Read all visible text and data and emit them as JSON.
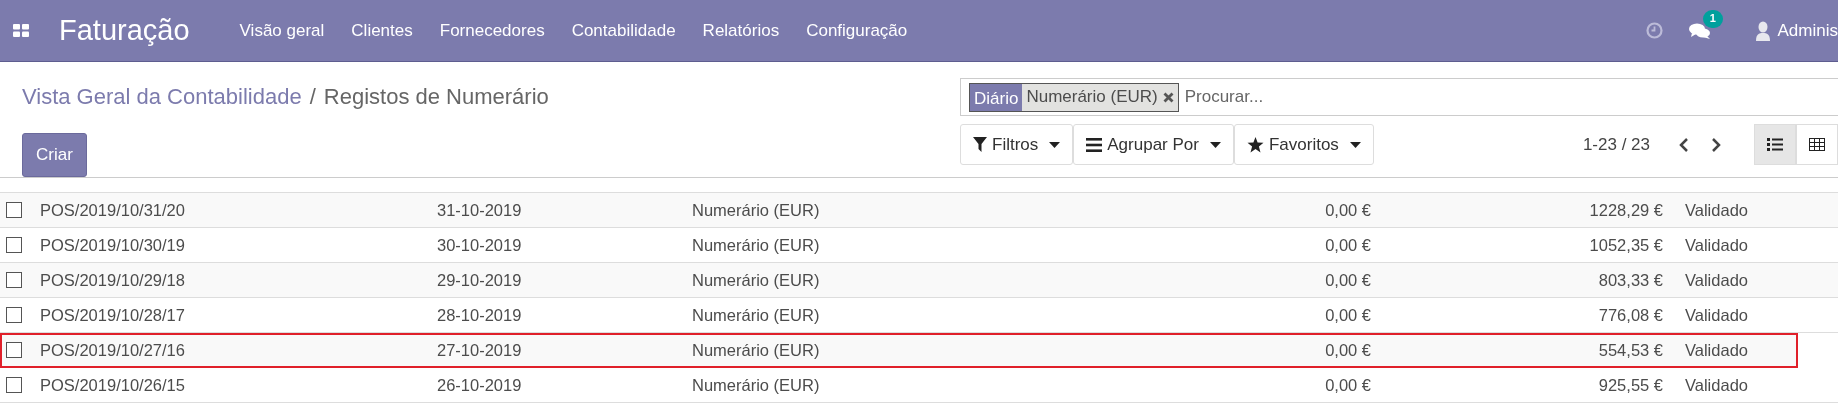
{
  "navbar": {
    "app_title": "Faturação",
    "menu": [
      "Visão geral",
      "Clientes",
      "Fornecedores",
      "Contabilidade",
      "Relatórios",
      "Configuração"
    ],
    "messages_badge": "1",
    "user": "Adminis"
  },
  "breadcrumb": [
    {
      "label": "Vista Geral da Contabilidade",
      "link": true
    },
    {
      "label": "Registos de Numerário",
      "link": false
    }
  ],
  "breadcrumb_separator": "/",
  "create_button": "Criar",
  "search": {
    "facet_label": "Diário",
    "facet_value": "Numerário (EUR)",
    "placeholder": "Procurar..."
  },
  "filters": [
    {
      "kind": "filter",
      "label": "Filtros"
    },
    {
      "kind": "group",
      "label": "Agrupar Por"
    },
    {
      "kind": "favorite",
      "label": "Favoritos"
    }
  ],
  "pager": "1-23 / 23",
  "views": [
    {
      "kind": "list",
      "selected": true
    },
    {
      "kind": "grid",
      "selected": false
    }
  ],
  "rows": [
    {
      "name": "POS/2019/10/31/20",
      "date": "31-10-2019",
      "journal": "Numerário (EUR)",
      "amount": "0,00 €",
      "balance": "1228,29 €",
      "status": "Validado",
      "checked": false,
      "highlighted": false
    },
    {
      "name": "POS/2019/10/30/19",
      "date": "30-10-2019",
      "journal": "Numerário (EUR)",
      "amount": "0,00 €",
      "balance": "1052,35 €",
      "status": "Validado",
      "checked": false,
      "highlighted": false
    },
    {
      "name": "POS/2019/10/29/18",
      "date": "29-10-2019",
      "journal": "Numerário (EUR)",
      "amount": "0,00 €",
      "balance": "803,33 €",
      "status": "Validado",
      "checked": false,
      "highlighted": false
    },
    {
      "name": "POS/2019/10/28/17",
      "date": "28-10-2019",
      "journal": "Numerário (EUR)",
      "amount": "0,00 €",
      "balance": "776,08 €",
      "status": "Validado",
      "checked": false,
      "highlighted": false
    },
    {
      "name": "POS/2019/10/27/16",
      "date": "27-10-2019",
      "journal": "Numerário (EUR)",
      "amount": "0,00 €",
      "balance": "554,53 €",
      "status": "Validado",
      "checked": false,
      "highlighted": true
    },
    {
      "name": "POS/2019/10/26/15",
      "date": "26-10-2019",
      "journal": "Numerário (EUR)",
      "amount": "0,00 €",
      "balance": "925,55 €",
      "status": "Validado",
      "checked": false,
      "highlighted": false
    }
  ]
}
